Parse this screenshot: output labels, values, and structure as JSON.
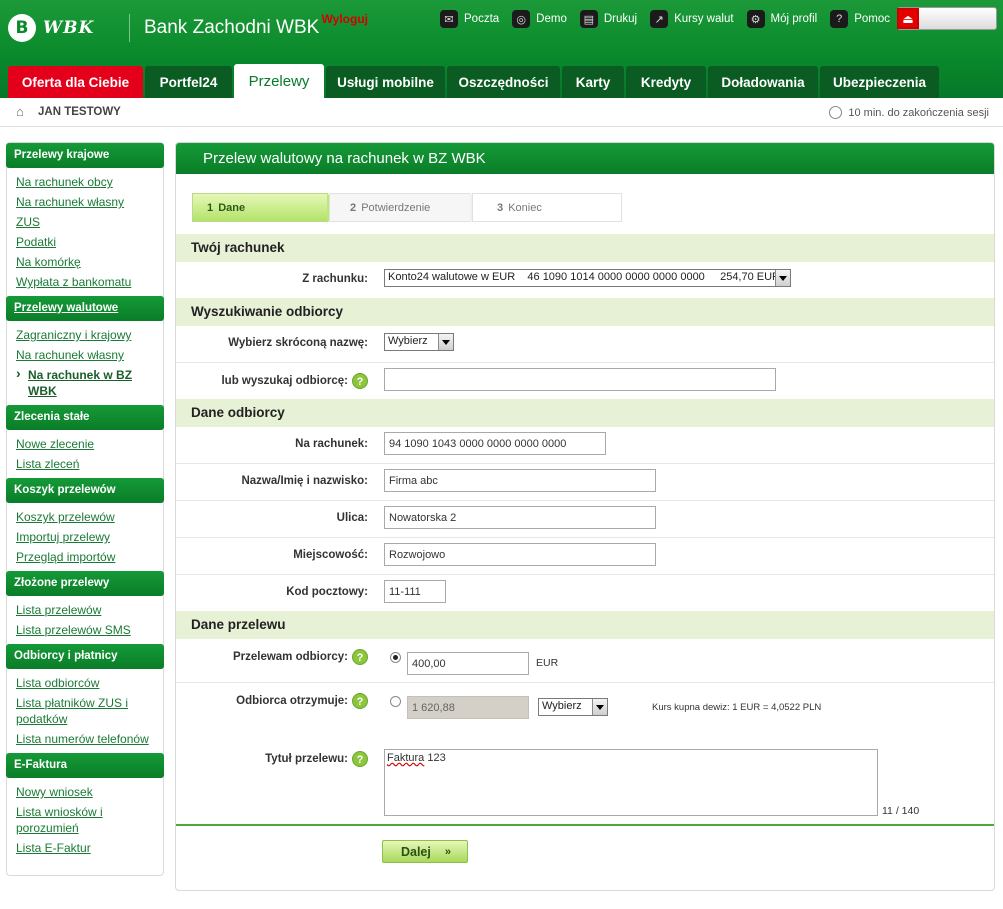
{
  "header": {
    "logo_mark": "B",
    "logo_text": "WBK",
    "bank_name": "Bank Zachodni WBK",
    "links": [
      {
        "label": "Poczta",
        "icon": "mail-icon"
      },
      {
        "label": "Demo",
        "icon": "globe-icon"
      },
      {
        "label": "Drukuj",
        "icon": "printer-icon"
      },
      {
        "label": "Kursy walut",
        "icon": "chart-icon"
      },
      {
        "label": "Mój profil",
        "icon": "gear-icon"
      },
      {
        "label": "Pomoc",
        "icon": "help-icon"
      }
    ],
    "logout_label": "Wyloguj",
    "accent_color": "#0a8a2b",
    "logout_color": "#d40000"
  },
  "nav": {
    "tabs": [
      {
        "label": "Oferta dla Ciebie"
      },
      {
        "label": "Portfel24"
      },
      {
        "label": "Przelewy"
      },
      {
        "label": "Usługi mobilne"
      },
      {
        "label": "Oszczędności"
      },
      {
        "label": "Karty"
      },
      {
        "label": "Kredyty"
      },
      {
        "label": "Doładowania"
      },
      {
        "label": "Ubezpieczenia"
      }
    ],
    "active_index": 2
  },
  "userbar": {
    "user_name": "JAN TESTOWY",
    "session": "10 min. do zakończenia sesji"
  },
  "sidebar": {
    "sections": [
      {
        "title": "Przelewy krajowe",
        "items": [
          "Na rachunek obcy",
          "Na rachunek własny",
          "ZUS",
          "Podatki",
          "Na komórkę",
          "Wypłata z bankomatu"
        ]
      },
      {
        "title": "Przelewy walutowe",
        "items": [
          "Zagraniczny i krajowy",
          "Na rachunek własny",
          "Na rachunek w BZ WBK"
        ],
        "active_item": 2
      },
      {
        "title": "Zlecenia stałe",
        "items": [
          "Nowe zlecenie",
          "Lista zleceń"
        ]
      },
      {
        "title": "Koszyk przelewów",
        "items": [
          "Koszyk przelewów",
          "Importuj przelewy",
          "Przegląd importów"
        ]
      },
      {
        "title": "Złożone przelewy",
        "items": [
          "Lista przelewów",
          "Lista przelewów SMS"
        ]
      },
      {
        "title": "Odbiorcy i płatnicy",
        "items": [
          "Lista odbiorców",
          "Lista płatników ZUS i podatków",
          "Lista numerów telefonów"
        ]
      },
      {
        "title": "E-Faktura",
        "items": [
          "Nowy wniosek",
          "Lista wniosków i porozumień",
          "Lista E-Faktur"
        ]
      }
    ]
  },
  "main": {
    "title": "Przelew walutowy na rachunek w BZ WBK",
    "steps": [
      {
        "num": "1",
        "label": "Dane"
      },
      {
        "num": "2",
        "label": "Potwierdzenie"
      },
      {
        "num": "3",
        "label": "Koniec"
      }
    ],
    "sections": {
      "account": "Twój rachunek",
      "search": "Wyszukiwanie odbiorcy",
      "recipient": "Dane odbiorcy",
      "transfer": "Dane przelewu"
    },
    "fields": {
      "from_account_label": "Z rachunku:",
      "from_account_value": "Konto24 walutowe w EUR    46 1090 1014 0000 0000 0000 0000     254,70 EUR",
      "short_name_label": "Wybierz skróconą nazwę:",
      "short_name_value": "Wybierz",
      "search_label": "lub wyszukaj odbiorcę:",
      "search_value": "",
      "to_account_label": "Na rachunek:",
      "to_account_value": "94 1090 1043 0000 0000 0000 0000",
      "name_label": "Nazwa/Imię i nazwisko:",
      "name_value": "Firma abc",
      "street_label": "Ulica:",
      "street_value": "Nowatorska 2",
      "city_label": "Miejscowość:",
      "city_value": "Rozwojowo",
      "zip_label": "Kod pocztowy:",
      "zip_value": "11-111",
      "send_label": "Przelewam odbiorcy:",
      "send_value": "400,00",
      "send_currency": "EUR",
      "receive_label": "Odbiorca otrzymuje:",
      "receive_value": "1 620,88",
      "receive_currency": "Wybierz",
      "rate_text": "Kurs kupna dewiz: 1 EUR = 4,0522 PLN",
      "title_label": "Tytuł przelewu:",
      "title_word1": "Faktura",
      "title_word2": " 123",
      "char_count": "11 / 140"
    },
    "next_button": "Dalej",
    "next_icon": "»"
  }
}
